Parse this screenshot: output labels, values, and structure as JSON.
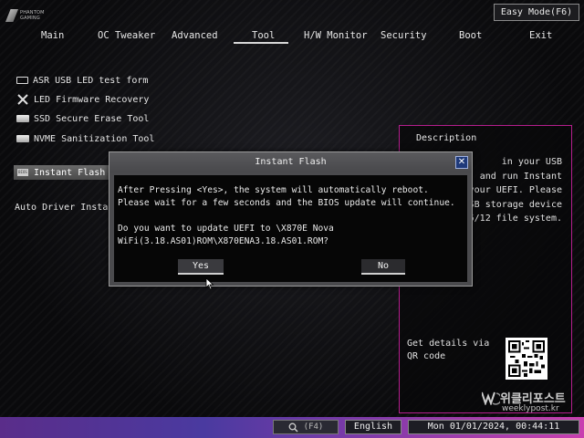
{
  "brand": {
    "logo_line1": "PHANTOM",
    "logo_line2": "GAMING"
  },
  "top": {
    "easy_mode_label": "Easy Mode(F6)"
  },
  "menu": {
    "items": [
      "Main",
      "OC Tweaker",
      "Advanced",
      "Tool",
      "H/W Monitor",
      "Security",
      "Boot",
      "Exit"
    ],
    "active": "Tool"
  },
  "tools": [
    {
      "label": "ASR USB LED test form",
      "icon": "usb-icon"
    },
    {
      "label": "LED Firmware Recovery",
      "icon": "wrench-screwdriver-icon"
    },
    {
      "label": "SSD Secure Erase Tool",
      "icon": "drive-icon"
    },
    {
      "label": "NVME Sanitization Tool",
      "icon": "drive-icon"
    }
  ],
  "instant_flash": {
    "label": "Instant Flash",
    "icon_text": "BIOS"
  },
  "auto_driver": {
    "label": "Auto Driver Installer"
  },
  "description": {
    "title": "Description",
    "text": "in your USB\nand run Instant\nyour UEFI. Please\nUSB storage device\n6/12 file system.",
    "details": "Get details via QR code"
  },
  "dialog": {
    "title": "Instant Flash",
    "close_label": "✕",
    "message": "After Pressing <Yes>, the system will automatically reboot.\nPlease wait for a few seconds and the BIOS update will continue.\n\nDo you want to update UEFI to \\X870E Nova\nWiFi(3.18.AS01)ROM\\X870ENA3.18.AS01.ROM?",
    "yes_label": "Yes",
    "no_label": "No"
  },
  "bottom": {
    "search_hint": "(F4)",
    "language": "English",
    "clock": "Mon 01/01/2024, 00:44:11"
  },
  "watermark": {
    "main": "위클리포스트",
    "sub": "weeklypost.kr"
  },
  "colors": {
    "accent_magenta": "#b51e8d",
    "bottom_bar_start": "#5a2d8a",
    "bottom_bar_end": "#c93fb0",
    "dialog_close": "#1f3a7a"
  }
}
